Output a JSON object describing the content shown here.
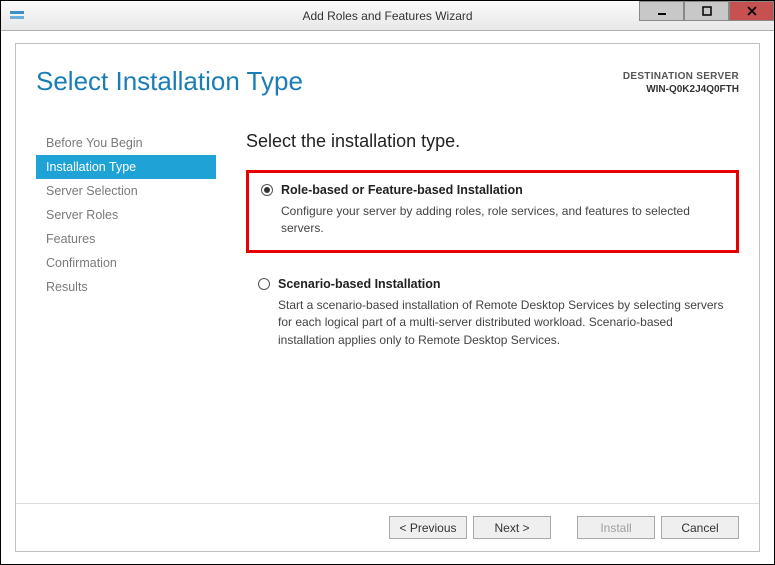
{
  "titlebar": {
    "title": "Add Roles and Features Wizard"
  },
  "header": {
    "page_title": "Select Installation Type",
    "destination_label": "DESTINATION SERVER",
    "destination_name": "WIN-Q0K2J4Q0FTH"
  },
  "sidebar": {
    "items": [
      {
        "label": "Before You Begin",
        "active": false
      },
      {
        "label": "Installation Type",
        "active": true
      },
      {
        "label": "Server Selection",
        "active": false
      },
      {
        "label": "Server Roles",
        "active": false
      },
      {
        "label": "Features",
        "active": false
      },
      {
        "label": "Confirmation",
        "active": false
      },
      {
        "label": "Results",
        "active": false
      }
    ]
  },
  "main": {
    "heading": "Select the installation type.",
    "options": [
      {
        "title": "Role-based or Feature-based Installation",
        "desc": "Configure your server by adding roles, role services, and features to selected servers.",
        "selected": true,
        "highlighted": true
      },
      {
        "title": "Scenario-based Installation",
        "desc": "Start a scenario-based installation of Remote Desktop Services by selecting servers for each logical part of a multi-server distributed workload. Scenario-based installation applies only to Remote Desktop Services.",
        "selected": false,
        "highlighted": false
      }
    ]
  },
  "footer": {
    "previous": "< Previous",
    "next": "Next >",
    "install": "Install",
    "cancel": "Cancel"
  }
}
